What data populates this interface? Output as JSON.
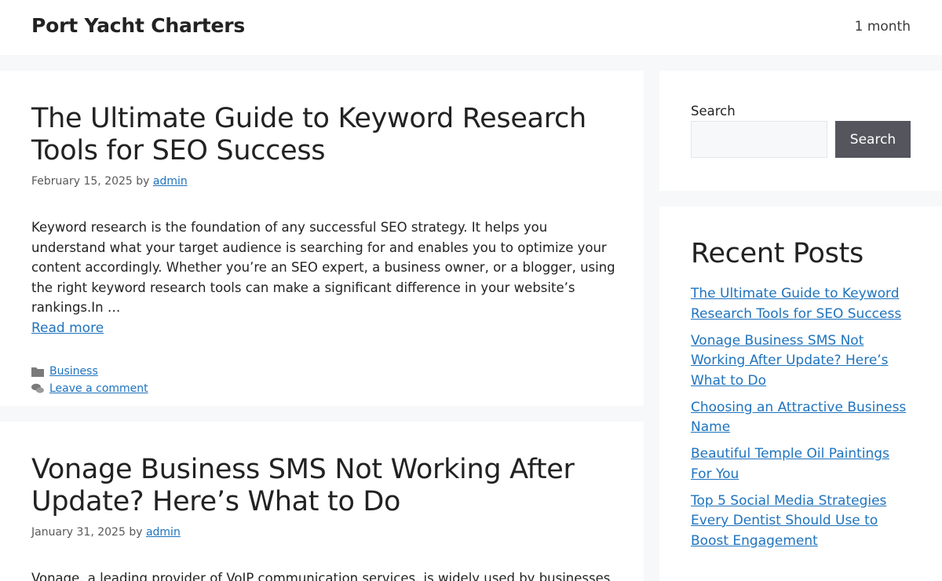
{
  "header": {
    "site_title": "Port Yacht Charters",
    "nav_item": "1 month"
  },
  "posts": [
    {
      "title": "The Ultimate Guide to Keyword Research Tools for SEO Success",
      "date": "February 15, 2025",
      "by": "by",
      "author": "admin",
      "summary": "Keyword research is the foundation of any successful SEO strategy. It helps you understand what your target audience is searching for and enables you to optimize your content accordingly. Whether you’re an SEO expert, a business owner, or a blogger, using the right keyword research tools can make a significant difference in your website’s rankings.In …",
      "read_more": "Read more",
      "category": "Business",
      "comment_link": "Leave a comment"
    },
    {
      "title": "Vonage Business SMS Not Working After Update? Here’s What to Do",
      "date": "January 31, 2025",
      "by": "by",
      "author": "admin",
      "summary": "Vonage, a leading provider of VoIP communication services, is widely used by businesses"
    }
  ],
  "sidebar": {
    "search_label": "Search",
    "search_placeholder": "",
    "search_button": "Search",
    "recent_title": "Recent Posts",
    "recent_posts": [
      "The Ultimate Guide to Keyword Research Tools for SEO Success",
      "Vonage Business SMS Not Working After Update? Here’s What to Do",
      "Choosing an Attractive Business Name",
      "Beautiful Temple Oil Paintings For You",
      "Top 5 Social Media Strategies Every Dentist Should Use to Boost Engagement"
    ]
  },
  "colors": {
    "link": "#1e73be",
    "search_button_bg": "#55555e",
    "page_bg": "#f7f8f9"
  },
  "icons": {
    "category": "folder-icon",
    "comments": "comments-icon"
  }
}
